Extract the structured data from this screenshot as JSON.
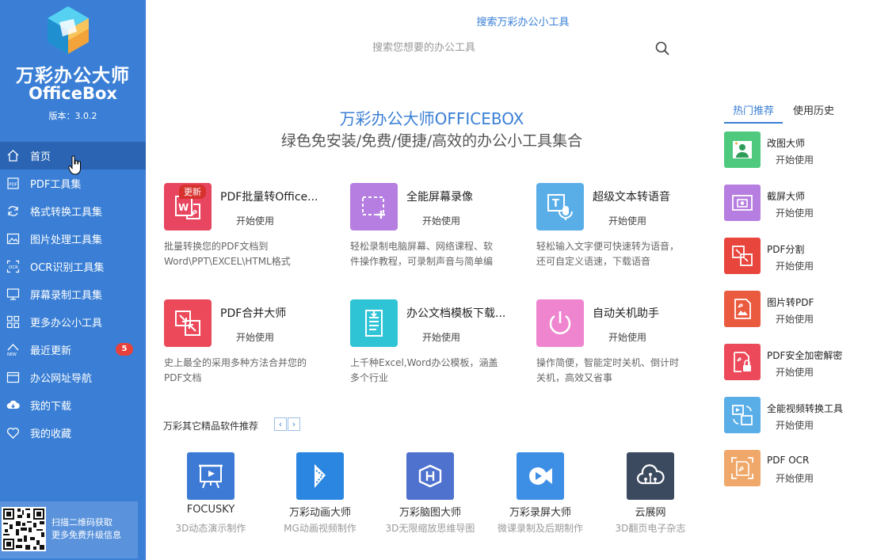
{
  "sidebar": {
    "app_name": "万彩办公大师",
    "app_name_en": "OfficeBox",
    "version": "版本：3.0.2",
    "items": [
      {
        "label": "首页",
        "icon": "home-icon"
      },
      {
        "label": "PDF工具集",
        "icon": "pdf-icon"
      },
      {
        "label": "格式转换工具集",
        "icon": "convert-icon"
      },
      {
        "label": "图片处理工具集",
        "icon": "image-icon"
      },
      {
        "label": "OCR识别工具集",
        "icon": "ocr-icon"
      },
      {
        "label": "屏幕录制工具集",
        "icon": "monitor-icon"
      },
      {
        "label": "更多办公小工具",
        "icon": "grid-icon"
      },
      {
        "label": "最近更新",
        "icon": "new-icon",
        "badge": "5"
      },
      {
        "label": "办公网址导航",
        "icon": "browser-icon"
      },
      {
        "label": "我的下载",
        "icon": "cloud-download-icon"
      },
      {
        "label": "我的收藏",
        "icon": "heart-icon"
      }
    ],
    "qr_text_1": "扫描二维码获取",
    "qr_text_2": "更多免费升级信息"
  },
  "search": {
    "title": "搜索万彩办公小工具",
    "placeholder": "搜索您想要的办公工具"
  },
  "hero": {
    "title": "万彩办公大师OFFICEBOX",
    "subtitle": "绿色免安装/免费/便捷/高效的办公小工具集合"
  },
  "tools": [
    {
      "name": "PDF批量转Office...",
      "start": "开始使用",
      "tag": "更新",
      "desc1": "批量转换您的PDF文档到",
      "desc2": "Word\\PPT\\EXCEL\\HTML格式",
      "color": "#e84561"
    },
    {
      "name": "全能屏幕录像",
      "start": "开始使用",
      "desc1": "轻松录制电脑屏幕、网络课程、软",
      "desc2": "件操作教程，可录制声音与简单编",
      "color": "#b57ee0"
    },
    {
      "name": "超级文本转语音",
      "start": "开始使用",
      "desc1": "轻松输入文字便可快速转为语音，",
      "desc2": "还可自定义语速，下载语音",
      "color": "#5aaee8"
    },
    {
      "name": "PDF合并大师",
      "start": "开始使用",
      "desc1": "史上最全的采用多种方法合并您的",
      "desc2": "PDF文档",
      "color": "#ec4a5a"
    },
    {
      "name": "办公文档模板下载...",
      "start": "开始使用",
      "desc1": "上千种Excel,Word办公模板，涵盖",
      "desc2": "多个行业",
      "color": "#2ec4d6"
    },
    {
      "name": "自动关机助手",
      "start": "开始使用",
      "desc1": "操作简便，智能定时关机、倒计时",
      "desc2": "关机，高效又省事",
      "color": "#ef85cf"
    }
  ],
  "recommend": {
    "label": "万彩其它精品软件推荐",
    "prev": "‹",
    "next": "›",
    "products": [
      {
        "name": "FOCUSKY",
        "desc": "3D动态演示制作",
        "color": "#3c7ad6"
      },
      {
        "name": "万彩动画大师",
        "desc": "MG动画视频制作",
        "color": "#2a86e0"
      },
      {
        "name": "万彩脑图大师",
        "desc": "3D无限缩放思维导图",
        "color": "#4f72cf"
      },
      {
        "name": "万彩录屏大师",
        "desc": "微课录制及后期制作",
        "color": "#3d8fe6"
      },
      {
        "name": "云展网",
        "desc": "3D翻页电子杂志",
        "color": "#3b4a5e"
      }
    ]
  },
  "right_panel": {
    "tab_hot": "热门推荐",
    "tab_history": "使用历史",
    "items": [
      {
        "name": "改图大师",
        "start": "开始使用",
        "color": "#4fc97e"
      },
      {
        "name": "截屏大师",
        "start": "开始使用",
        "color": "#b57ee0"
      },
      {
        "name": "PDF分割",
        "start": "开始使用",
        "color": "#e8453c"
      },
      {
        "name": "图片转PDF",
        "start": "开始使用",
        "color": "#ea5a3e"
      },
      {
        "name": "PDF安全加密解密",
        "start": "开始使用",
        "color": "#ec4a5a"
      },
      {
        "name": "全能视频转换工具",
        "start": "开始使用",
        "color": "#5aaee8"
      },
      {
        "name": "PDF OCR",
        "start": "开始使用",
        "color": "#f0a86a"
      }
    ]
  }
}
